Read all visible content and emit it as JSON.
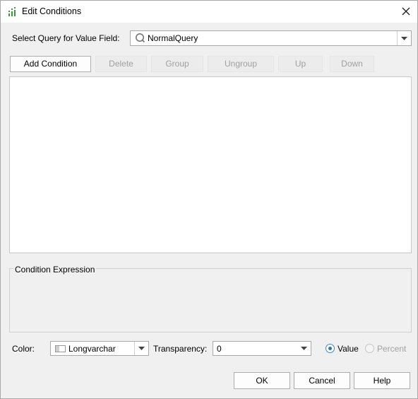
{
  "window": {
    "title": "Edit Conditions",
    "icon": "chart-bars-icon",
    "close_icon": "close-icon"
  },
  "query": {
    "label": "Select Query for Value Field:",
    "value": "NormalQuery",
    "icon": "query-q-icon"
  },
  "toolbar": {
    "add_condition": "Add Condition",
    "delete": "Delete",
    "group": "Group",
    "ungroup": "Ungroup",
    "up": "Up",
    "down": "Down"
  },
  "expression": {
    "title": "Condition Expression"
  },
  "options": {
    "color_label": "Color:",
    "color_value": "Longvarchar",
    "transparency_label": "Transparency:",
    "transparency_value": "0",
    "value_radio": "Value",
    "percent_radio": "Percent",
    "selected_radio": "Value"
  },
  "footer": {
    "ok": "OK",
    "cancel": "Cancel",
    "help": "Help"
  },
  "colors": {
    "accent": "#2d6fc9",
    "icon_green": "#3a9a3a",
    "disabled_text": "#a0a0a0"
  }
}
